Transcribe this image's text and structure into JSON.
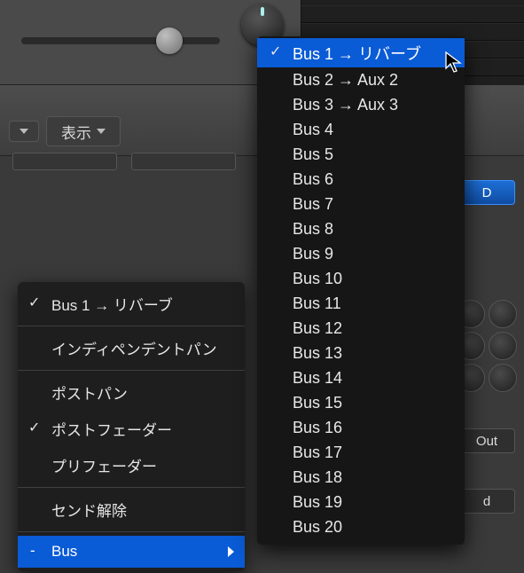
{
  "toolbar": {
    "show_label": "表示"
  },
  "pills": {
    "d": "D",
    "out": "Out",
    "d2": "d"
  },
  "context_menu": {
    "current_send": "Bus 1 → リバーブ",
    "independent_pan": "インディペンデントパン",
    "post_pan": "ポストパン",
    "post_fader": "ポストフェーダー",
    "pre_fader": "プリフェーダー",
    "remove_send": "センド解除",
    "bus_submenu": "Bus"
  },
  "bus_menu": {
    "items": [
      "Bus 1 → リバーブ",
      "Bus 2 → Aux 2",
      "Bus 3 → Aux 3",
      "Bus 4",
      "Bus 5",
      "Bus 6",
      "Bus 7",
      "Bus 8",
      "Bus 9",
      "Bus 10",
      "Bus 11",
      "Bus 12",
      "Bus 13",
      "Bus 14",
      "Bus 15",
      "Bus 16",
      "Bus 17",
      "Bus 18",
      "Bus 19",
      "Bus 20"
    ]
  }
}
